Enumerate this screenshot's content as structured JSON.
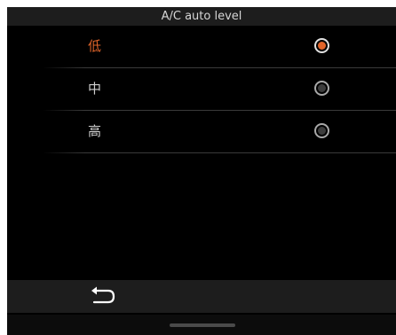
{
  "header": {
    "title": "A/C auto level"
  },
  "options": [
    {
      "label": "低",
      "selected": true
    },
    {
      "label": "中",
      "selected": false
    },
    {
      "label": "高",
      "selected": false
    }
  ],
  "colors": {
    "accent": "#e0642a",
    "background": "#000000",
    "bar": "#1d1d1d"
  },
  "icons": {
    "back": "back-arrow-icon",
    "radio": "radio-button"
  }
}
